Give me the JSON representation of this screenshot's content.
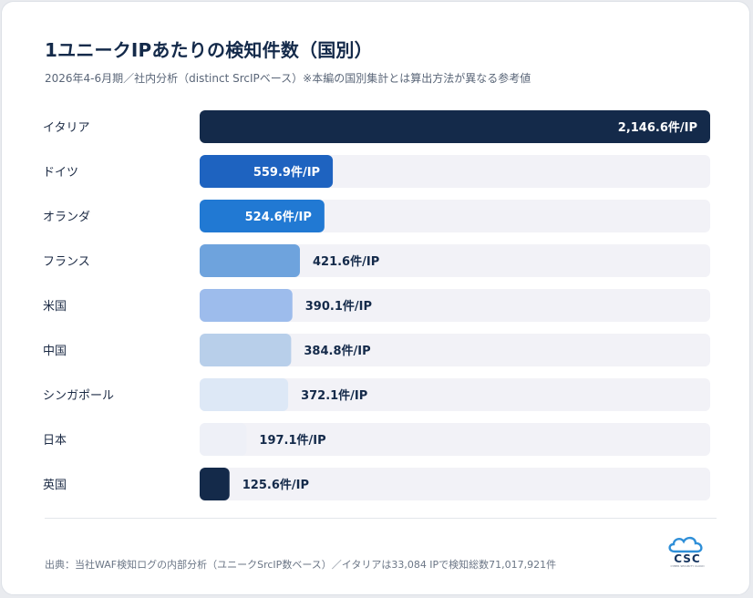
{
  "title": "1ユニークIPあたりの検知件数（国別）",
  "subtitle": "2026年4-6月期／社内分析（distinct SrcIPベース）※本編の国別集計とは算出方法が異なる参考値",
  "footer": {
    "source": "出典：当社WAF検知ログの内部分析（ユニークSrcIP数ベース）／イタリアは33,084 IPで検知総数71,017,921件",
    "logo_text": "CSC",
    "logo_sub": "CYBER SECURITY CLOUD"
  },
  "colors": {
    "track": "#f2f2f7",
    "bars": [
      "#142a4a",
      "#1e63c0",
      "#2179d3",
      "#6ea3dd",
      "#9dbcec",
      "#b8cfea",
      "#dde8f6",
      "#eef0f7",
      "#142a4a"
    ],
    "label_on_bar": "#ffffff",
    "label_off_bar": "#142a4a"
  },
  "chart_data": {
    "type": "bar",
    "orientation": "horizontal",
    "categories": [
      "イタリア",
      "ドイツ",
      "オランダ",
      "フランス",
      "米国",
      "中国",
      "シンガポール",
      "日本",
      "英国"
    ],
    "values": [
      2146.6,
      559.9,
      524.6,
      421.6,
      390.1,
      384.8,
      372.1,
      197.1,
      125.6
    ],
    "data_labels": [
      "2,146.6件/IP",
      "559.9件/IP",
      "524.6件/IP",
      "421.6件/IP",
      "390.1件/IP",
      "384.8件/IP",
      "372.1件/IP",
      "197.1件/IP",
      "125.6件/IP"
    ],
    "xlim": [
      0,
      2146.6
    ],
    "grid": false,
    "legend": "none"
  }
}
